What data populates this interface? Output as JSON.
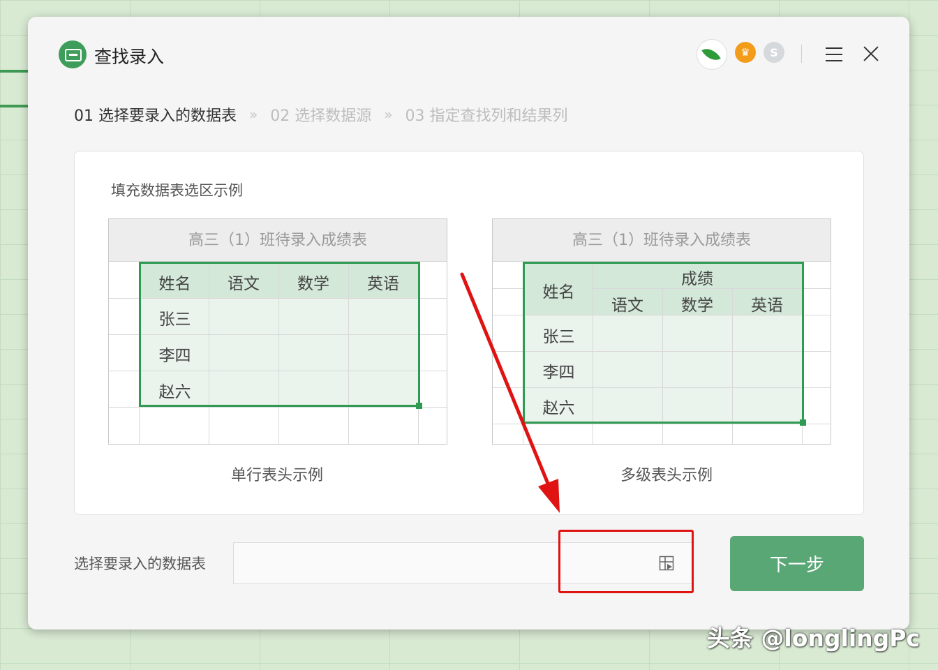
{
  "window": {
    "title": "查找录入"
  },
  "title_bar": {
    "icons": [
      "app-icon",
      "leaf-icon",
      "crown-icon",
      "coin-s-icon",
      "menu-icon",
      "close-icon"
    ],
    "coin_glyph": "S",
    "crown_glyph": "♛"
  },
  "steps": [
    {
      "label": "01 选择要录入的数据表",
      "active": true
    },
    {
      "label": "02 选择数据源",
      "active": false
    },
    {
      "label": "03 指定查找列和结果列",
      "active": false
    }
  ],
  "step_separator": "»",
  "example_panel": {
    "title": "填充数据表选区示例",
    "single_header": {
      "table_title": "高三（1）班待录入成绩表",
      "headers": [
        "姓名",
        "语文",
        "数学",
        "英语"
      ],
      "rows": [
        "张三",
        "李四",
        "赵六"
      ],
      "caption": "单行表头示例"
    },
    "multi_header": {
      "table_title": "高三（1）班待录入成绩表",
      "name_header": "姓名",
      "group_header": "成绩",
      "sub_headers": [
        "语文",
        "数学",
        "英语"
      ],
      "rows": [
        "张三",
        "李四",
        "赵六"
      ],
      "caption": "多级表头示例"
    }
  },
  "form": {
    "label": "选择要录入的数据表",
    "range_value": "",
    "next_button": "下一步"
  },
  "colors": {
    "accent": "#5aa776",
    "selection_border": "#2f9a52",
    "annotation_red": "#e01313"
  },
  "watermark": "头条 @longlingPc"
}
